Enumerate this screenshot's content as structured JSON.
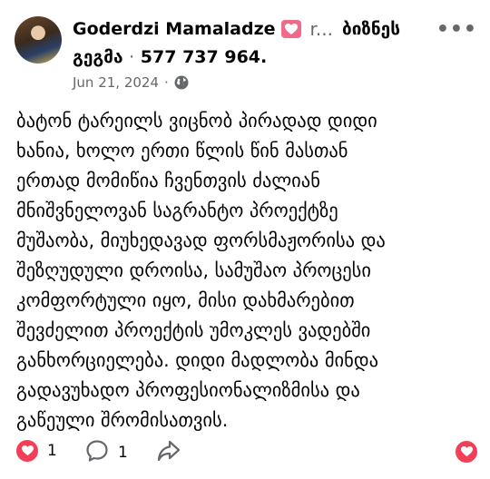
{
  "post": {
    "author": "Goderdzi Mamaladze",
    "group_short": "ბიზნეს",
    "group_line2": "გეგმა",
    "phone": "577 737 964",
    "arrow_text": "r...",
    "date": "Jun 21, 2024",
    "separator": "·",
    "body_lines": [
      "ბატონ ტარეილს ვიცნობ პირადად დიდი",
      "ხანია, ხოლო ერთი წლის წინ მასთან",
      "ერთად მომიწია ჩვენთვის ძალიან",
      "მნიშვნელოვან საგრანტო პროექტზე",
      "მუშაობა, მიუხედავად ფორსმაჟორისა და",
      "შეზღუდული დროისა, სამუშაო პროცესი",
      "კომფორტული იყო, მისი დახმარებით",
      "შევძელით პროექტის უმოკლეს ვადებში",
      "განხორციელება. დიდი მადლობა მინდა",
      "გადავუხადო პროფესიონალიზმისა და",
      "გაწეული შრომისათვის."
    ]
  },
  "footer": {
    "reaction_count": "1",
    "comment_count": "1"
  },
  "icons": {
    "badge": "heart-badge-icon",
    "more": "more-options-icon",
    "globe": "globe-icon",
    "reaction": "love-reaction-icon",
    "comment": "comment-icon",
    "share": "share-icon",
    "like": "heart-like-icon"
  },
  "colors": {
    "badge_pink": "#f06a8a",
    "reaction_red": "#f33e58",
    "meta_gray": "#65676b"
  }
}
